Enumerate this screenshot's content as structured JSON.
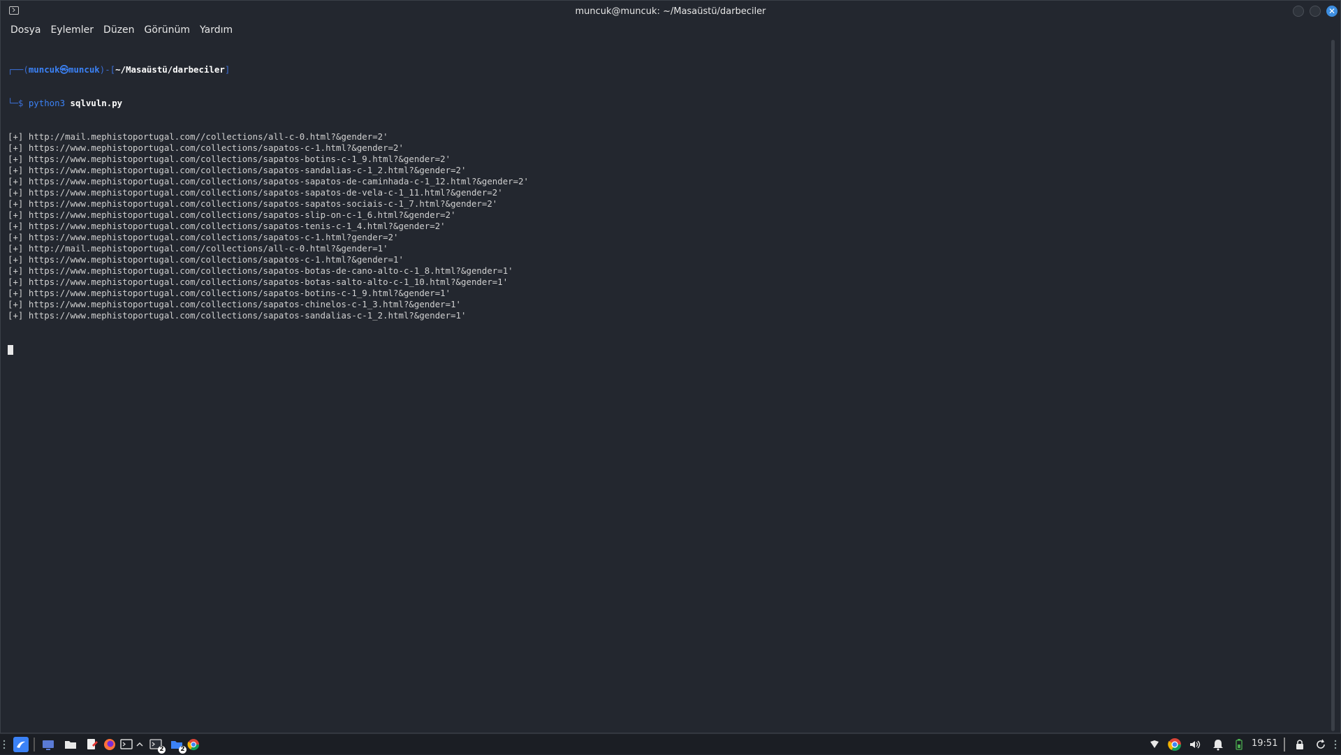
{
  "window": {
    "title": "muncuk@muncuk: ~/Masaüstü/darbeciler",
    "close_glyph": "✕"
  },
  "menu": {
    "items": [
      "Dosya",
      "Eylemler",
      "Düzen",
      "Görünüm",
      "Yardım"
    ]
  },
  "prompt": {
    "frame_top": "┌──(",
    "user": "muncuk㉿muncuk",
    "sep": ")-[",
    "path": "~/Masaüstü/darbeciler",
    "close": "]",
    "frame_bottom": "└─$ ",
    "cmd_prog": "python3",
    "cmd_arg": "sqlvuln.py"
  },
  "output_prefix": "[+]",
  "output": [
    "http://mail.mephistoportugal.com//collections/all-c-0.html?&gender=2'",
    "https://www.mephistoportugal.com/collections/sapatos-c-1.html?&gender=2'",
    "https://www.mephistoportugal.com/collections/sapatos-botins-c-1_9.html?&gender=2'",
    "https://www.mephistoportugal.com/collections/sapatos-sandalias-c-1_2.html?&gender=2'",
    "https://www.mephistoportugal.com/collections/sapatos-sapatos-de-caminhada-c-1_12.html?&gender=2'",
    "https://www.mephistoportugal.com/collections/sapatos-sapatos-de-vela-c-1_11.html?&gender=2'",
    "https://www.mephistoportugal.com/collections/sapatos-sapatos-sociais-c-1_7.html?&gender=2'",
    "https://www.mephistoportugal.com/collections/sapatos-slip-on-c-1_6.html?&gender=2'",
    "https://www.mephistoportugal.com/collections/sapatos-tenis-c-1_4.html?&gender=2'",
    "https://www.mephistoportugal.com/collections/sapatos-c-1.html?gender=2'",
    "http://mail.mephistoportugal.com//collections/all-c-0.html?&gender=1'",
    "https://www.mephistoportugal.com/collections/sapatos-c-1.html?&gender=1'",
    "https://www.mephistoportugal.com/collections/sapatos-botas-de-cano-alto-c-1_8.html?&gender=1'",
    "https://www.mephistoportugal.com/collections/sapatos-botas-salto-alto-c-1_10.html?&gender=1'",
    "https://www.mephistoportugal.com/collections/sapatos-botins-c-1_9.html?&gender=1'",
    "https://www.mephistoportugal.com/collections/sapatos-chinelos-c-1_3.html?&gender=1'",
    "https://www.mephistoportugal.com/collections/sapatos-sandalias-c-1_2.html?&gender=1'"
  ],
  "taskbar": {
    "left_icons": [
      "app-menu-icon",
      "workspace-icon",
      "file-manager-icon",
      "text-editor-icon",
      "firefox-icon",
      "terminal-icon",
      "chevron-up-icon",
      "terminal-window-icon",
      "files-window-icon",
      "chrome-icon"
    ],
    "terminal_badge": "2",
    "files_badge": "2",
    "tray_icons": [
      "vpn-shield-icon",
      "chrome-tray-icon",
      "volume-icon",
      "notification-bell-icon",
      "battery-icon"
    ],
    "time": "19:51",
    "lock_icon": "lock-icon",
    "refresh_icon": "refresh-icon",
    "accent": "#3b82f6"
  }
}
